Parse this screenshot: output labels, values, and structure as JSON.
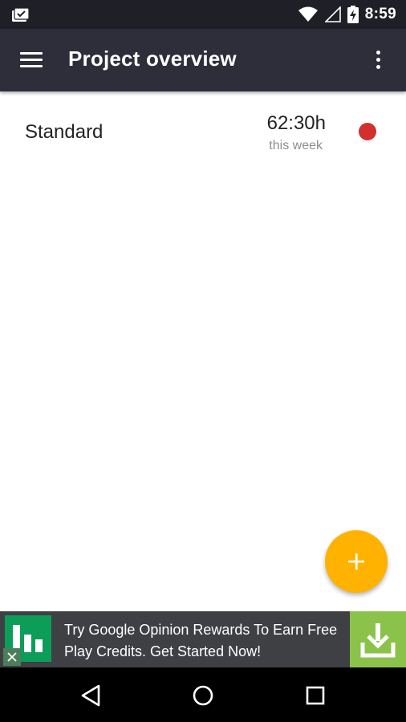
{
  "status_bar": {
    "time": "8:59",
    "icons": [
      "notification-icon",
      "wifi-icon",
      "cell-signal-icon",
      "battery-charging-icon"
    ]
  },
  "app_bar": {
    "title": "Project overview",
    "icons": [
      "menu-icon",
      "overflow-icon"
    ]
  },
  "projects": [
    {
      "name": "Standard",
      "time": "62:30h",
      "period": "this week",
      "status_color": "#d32f2f"
    }
  ],
  "fab": {
    "icon": "plus-icon",
    "color": "#ffb300"
  },
  "ad": {
    "text": "Try Google Opinion Rewards To Earn Free Play Credits. Get Started Now!",
    "icons": [
      "opinion-rewards-logo-icon",
      "close-icon",
      "download-icon"
    ],
    "download_color": "#8bc34a"
  },
  "nav_bar": {
    "icons": [
      "back-icon",
      "home-icon",
      "recents-icon"
    ]
  }
}
